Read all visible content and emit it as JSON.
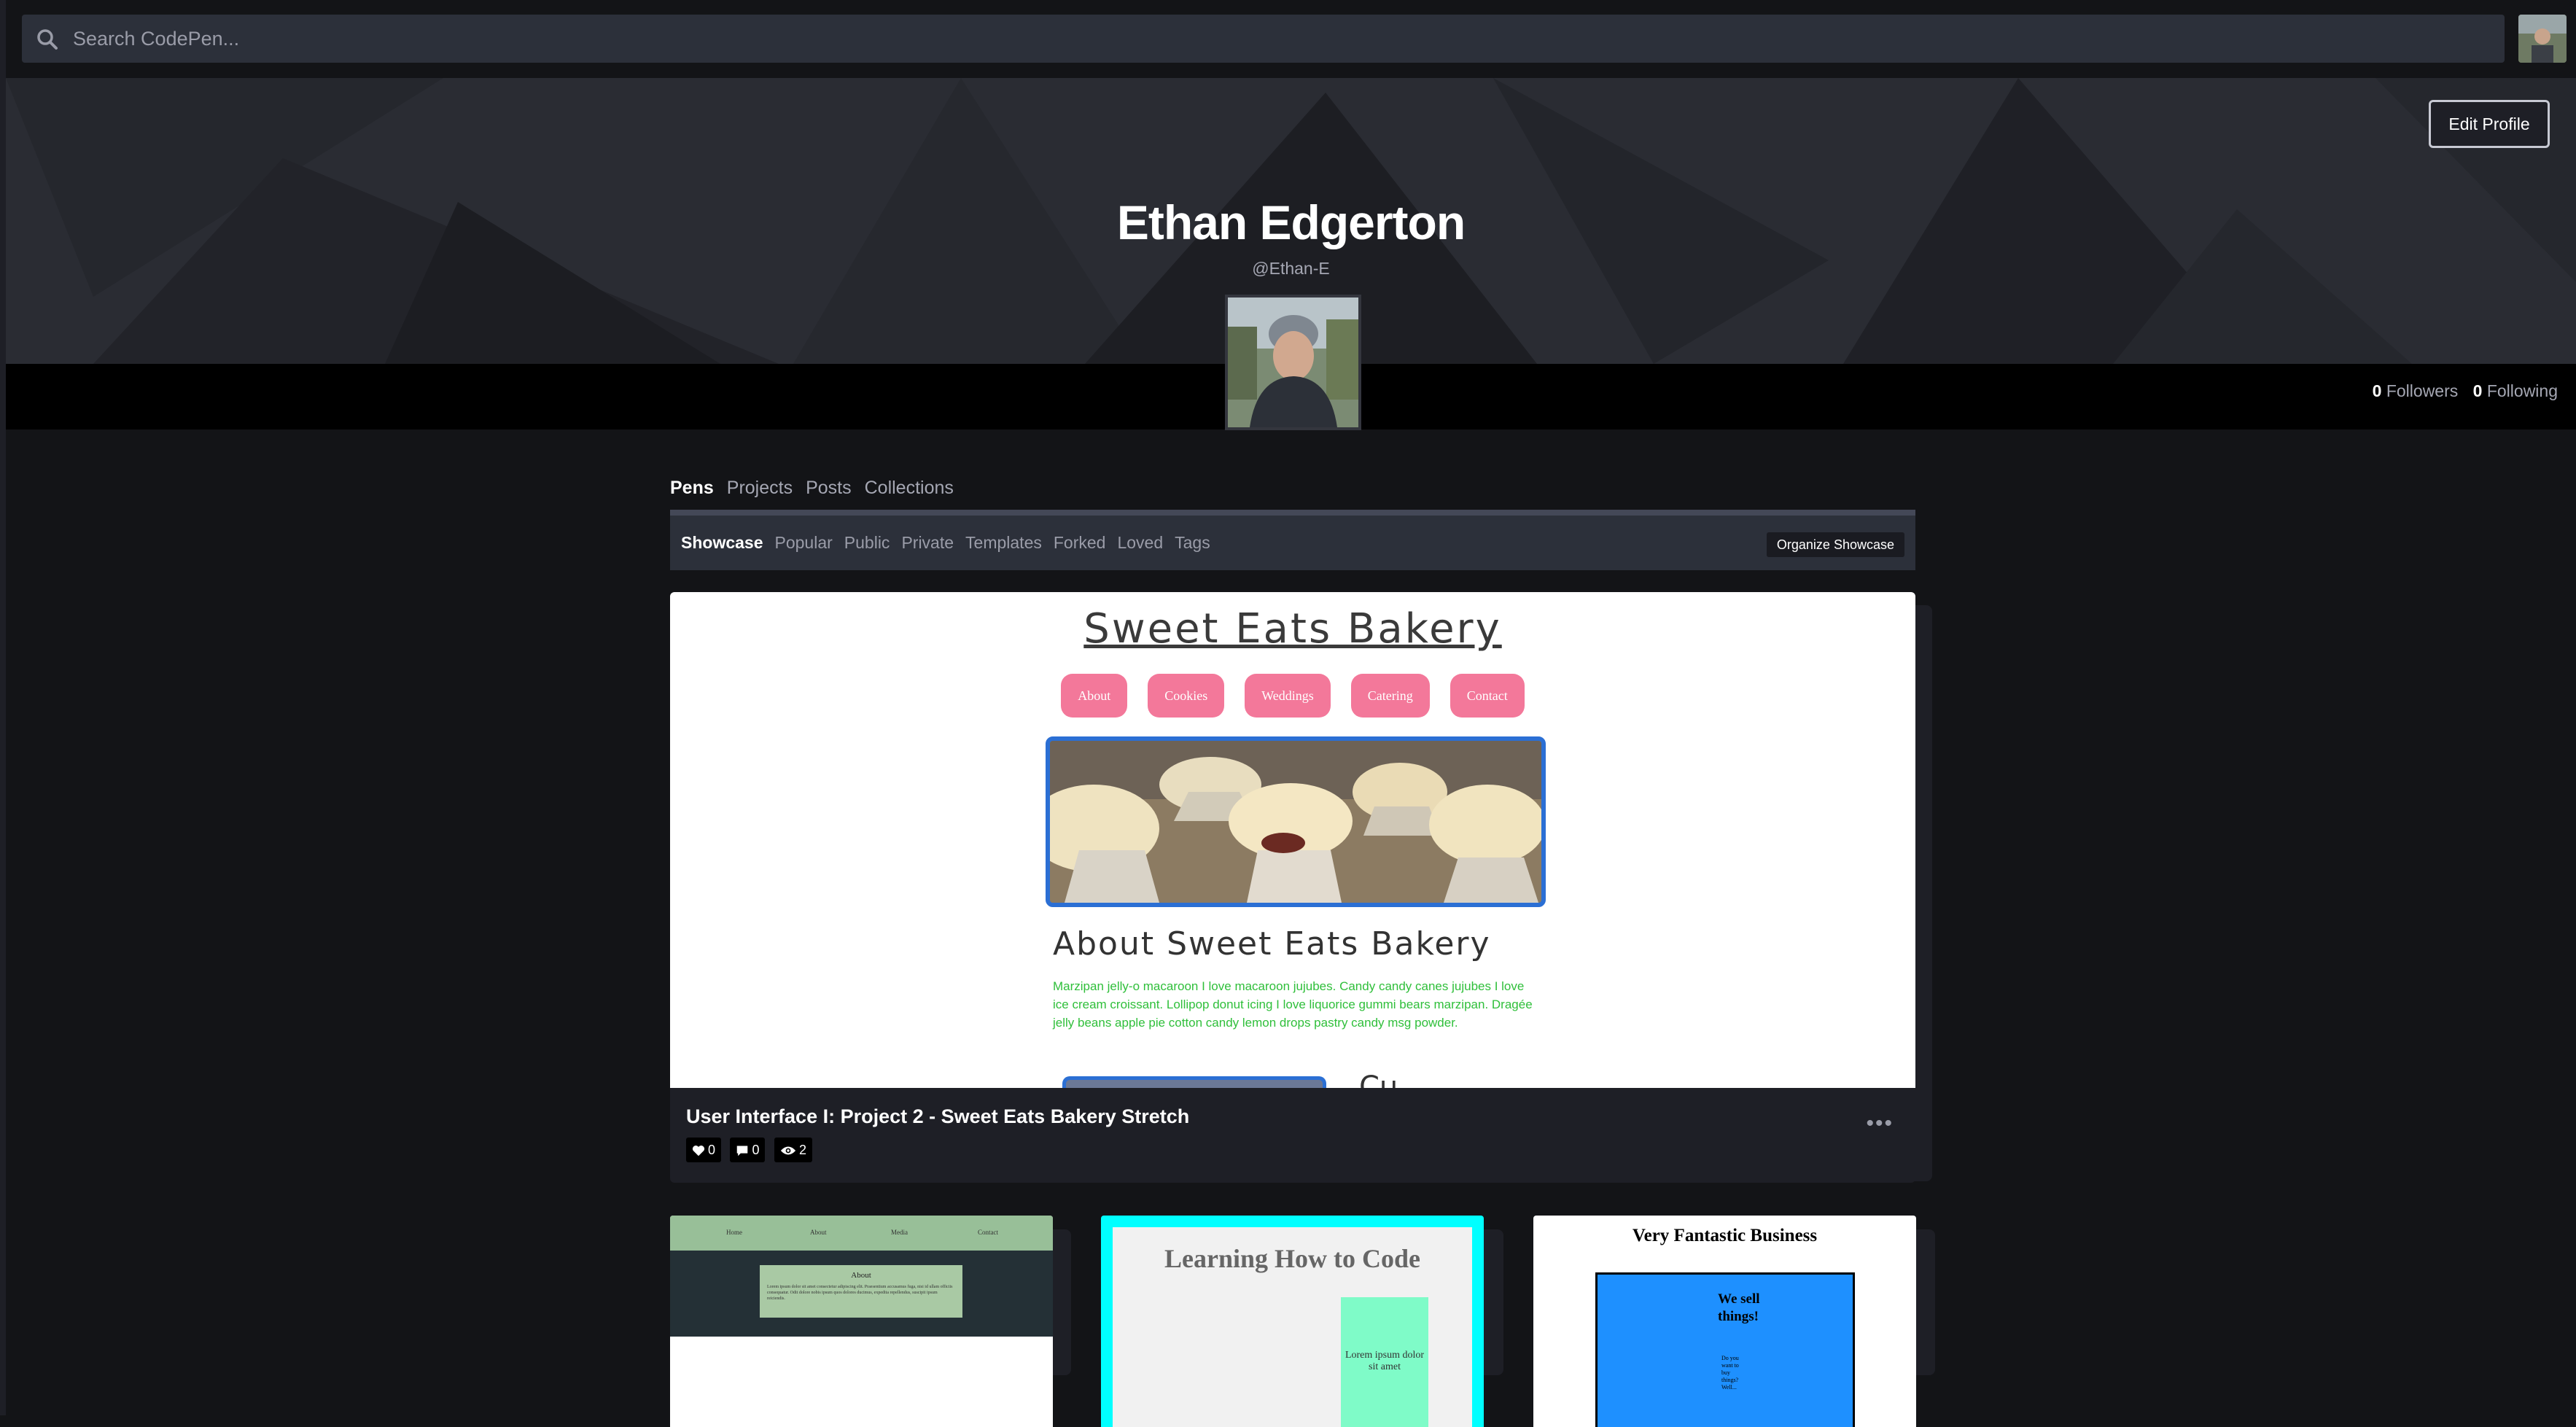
{
  "search": {
    "placeholder": "Search CodePen..."
  },
  "profile": {
    "name": "Ethan Edgerton",
    "handle": "@Ethan-E",
    "edit_label": "Edit Profile",
    "followers_count": "0",
    "followers_label": "Followers",
    "following_count": "0",
    "following_label": "Following"
  },
  "tabs": [
    {
      "label": "Pens",
      "active": true
    },
    {
      "label": "Projects"
    },
    {
      "label": "Posts"
    },
    {
      "label": "Collections"
    }
  ],
  "subnav": {
    "items": [
      "Showcase",
      "Popular",
      "Public",
      "Private",
      "Templates",
      "Forked",
      "Loved",
      "Tags"
    ],
    "organize_label": "Organize Showcase"
  },
  "featured": {
    "preview": {
      "title": "Sweet Eats Bakery",
      "nav": [
        "About",
        "Cookies",
        "Weddings",
        "Catering",
        "Contact"
      ],
      "about_heading": "About Sweet Eats Bakery",
      "about_text": "Marzipan jelly-o macaroon I love macaroon jujubes. Candy candy canes jujubes I love ice cream croissant. Lollipop donut icing I love liquorice gummi bears marzipan. Dragée jelly beans apple pie cotton candy lemon drops pastry candy msg powder.",
      "peek_heading": "Cu..."
    },
    "title": "User Interface I: Project 2 - Sweet Eats Bakery Stretch",
    "likes": "0",
    "comments": "0",
    "views": "2",
    "menu_icon": "more-dots-icon"
  },
  "thumbs": {
    "t1": {
      "nav": [
        "Home",
        "About",
        "Media",
        "Contact"
      ],
      "heading": "About",
      "text": "Lorem ipsum dolor sit amet consectetur adipiscing elit. Praesentium accusamus fuga, nisi id ullam officiis consequatur. Odit dolore nobis ipsum quos dolores ducimus, expedita repellendus, suscipit ipsum reiciendis."
    },
    "t2": {
      "heading": "Learning How to Code",
      "col_text": "Lorem ipsum dolor sit amet"
    },
    "t3": {
      "heading": "Very Fantastic Business",
      "big": "We sell things!",
      "small": "Do you want to buy things? Well..."
    }
  },
  "icons": {
    "search": "search-icon",
    "heart": "heart-icon",
    "comment": "comment-icon",
    "eye": "eye-icon"
  },
  "colors": {
    "background": "#131417",
    "panel": "#1e1f26",
    "accent_pink": "#f3789a",
    "preview_link_blue": "#2b6fd4",
    "about_text_green": "#2fbf3a"
  }
}
